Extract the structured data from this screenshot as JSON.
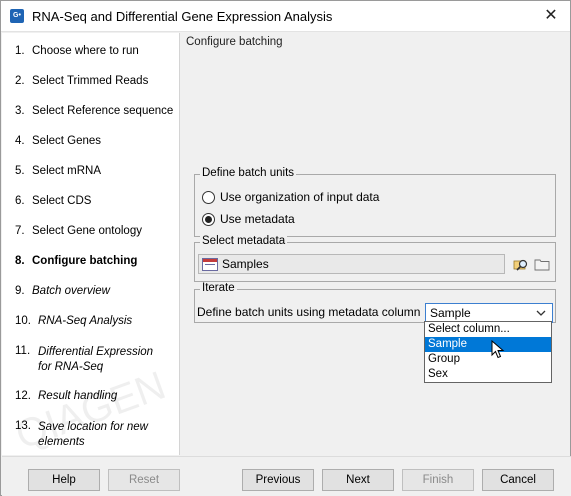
{
  "window": {
    "title": "RNA-Seq and Differential Gene Expression Analysis",
    "app_icon_text": "G•",
    "close_label": "✕"
  },
  "sidebar": {
    "steps": [
      {
        "num": "1.",
        "label": "Choose where to run",
        "state": "done"
      },
      {
        "num": "2.",
        "label": "Select Trimmed Reads",
        "state": "done"
      },
      {
        "num": "3.",
        "label": "Select Reference sequence",
        "state": "done"
      },
      {
        "num": "4.",
        "label": "Select Genes",
        "state": "done"
      },
      {
        "num": "5.",
        "label": "Select mRNA",
        "state": "done"
      },
      {
        "num": "6.",
        "label": "Select CDS",
        "state": "done"
      },
      {
        "num": "7.",
        "label": "Select Gene ontology",
        "state": "done"
      },
      {
        "num": "8.",
        "label": "Configure batching",
        "state": "current"
      },
      {
        "num": "9.",
        "label": "Batch overview",
        "state": "future"
      },
      {
        "num": "10.",
        "label": "RNA-Seq Analysis",
        "state": "future"
      },
      {
        "num": "11.",
        "label": "Differential Expression",
        "label2": "for RNA-Seq",
        "state": "future"
      },
      {
        "num": "12.",
        "label": "Result handling",
        "state": "future"
      },
      {
        "num": "13.",
        "label": "Save location for new",
        "label2": "elements",
        "state": "future"
      }
    ]
  },
  "main": {
    "section_title": "Configure batching",
    "batch_units": {
      "legend": "Define batch units",
      "options": [
        {
          "label": "Use organization of input data",
          "checked": false
        },
        {
          "label": "Use metadata",
          "checked": true
        }
      ]
    },
    "metadata": {
      "legend": "Select metadata",
      "value": "Samples"
    },
    "iterate": {
      "legend": "Iterate",
      "label": "Define batch units using metadata column",
      "selected": "Sample",
      "options": [
        "Select column...",
        "Sample",
        "Group",
        "Sex"
      ],
      "highlighted_index": 1
    }
  },
  "buttons": {
    "help": "Help",
    "reset": "Reset",
    "previous": "Previous",
    "next": "Next",
    "finish": "Finish",
    "cancel": "Cancel"
  },
  "colors": {
    "highlight": "#0078d7",
    "select_border": "#3c7fd0"
  }
}
